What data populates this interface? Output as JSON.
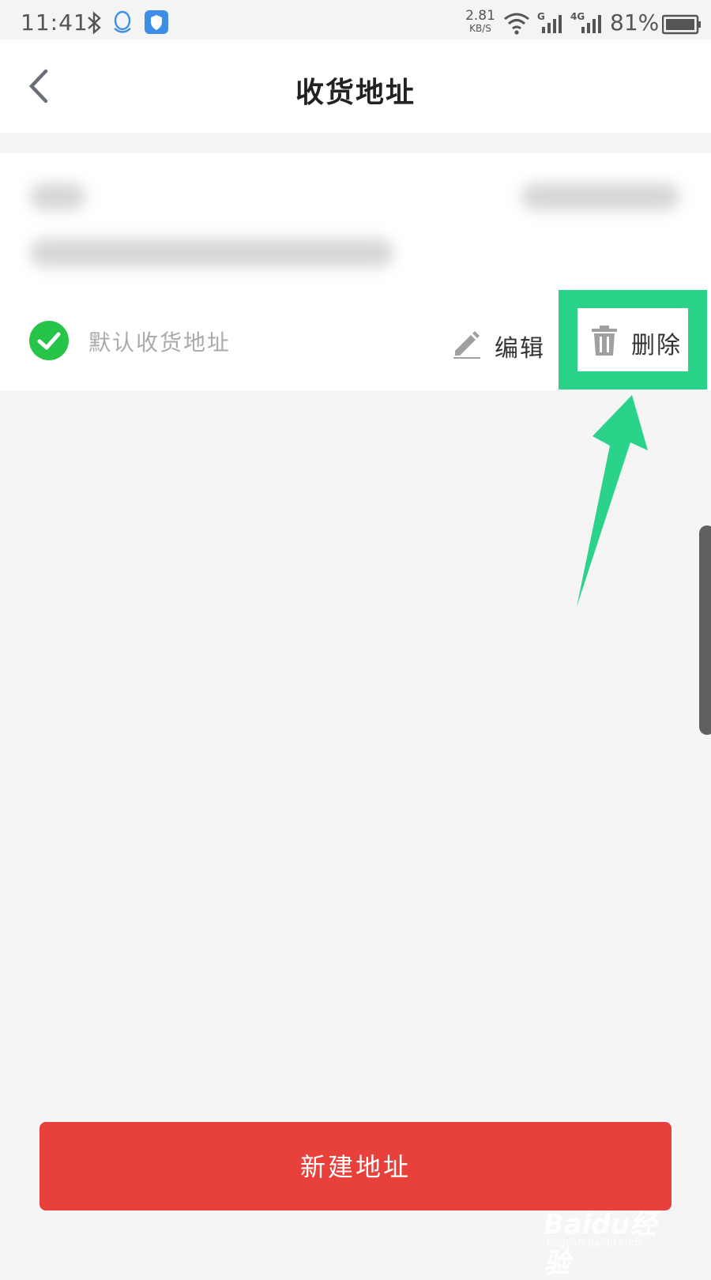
{
  "status_bar": {
    "time": "11:41",
    "net_speed_value": "2.81",
    "net_speed_unit": "KB/S",
    "signal_1_tag": "G",
    "signal_2_tag": "4G",
    "battery": "81%",
    "icons": [
      "bluetooth-icon",
      "qq-icon",
      "shield-app-icon",
      "wifi-icon",
      "signal-icon",
      "battery-icon"
    ]
  },
  "header": {
    "title": "收货地址",
    "back_icon": "chevron-left-icon"
  },
  "address_card": {
    "default_label": "默认收货地址",
    "edit_label": "编辑",
    "delete_label": "删除"
  },
  "footer": {
    "new_address_label": "新建地址"
  },
  "watermark": {
    "brand": "Baidu经验",
    "url": "jingyan.baidu.com"
  },
  "colors": {
    "accent_red": "#e8403a",
    "check_green": "#27c44a",
    "highlight_green": "#2ad28a"
  }
}
